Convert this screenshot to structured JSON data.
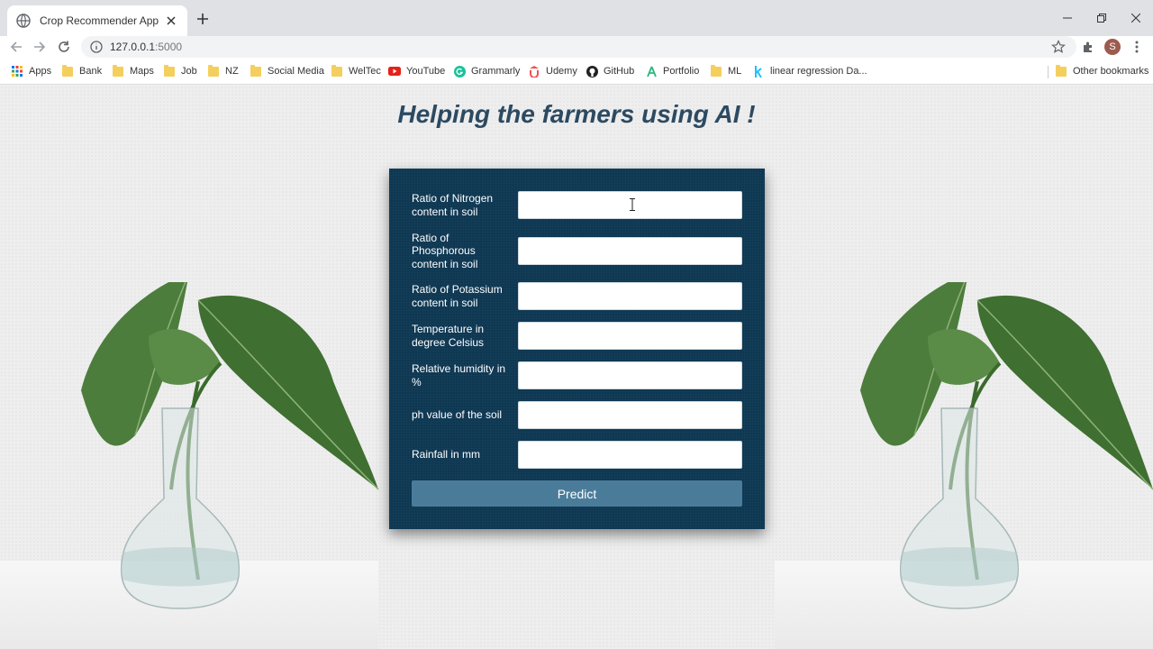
{
  "browser": {
    "tab_title": "Crop Recommender App",
    "url_host": "127.0.0.1",
    "url_port": ":5000",
    "avatar_letter": "S",
    "bookmarks": [
      {
        "label": "Apps",
        "icon": "apps-grid-icon"
      },
      {
        "label": "Bank",
        "icon": "folder-icon"
      },
      {
        "label": "Maps",
        "icon": "folder-icon"
      },
      {
        "label": "Job",
        "icon": "folder-icon"
      },
      {
        "label": "NZ",
        "icon": "folder-icon"
      },
      {
        "label": "Social Media",
        "icon": "folder-icon"
      },
      {
        "label": "WelTec",
        "icon": "folder-icon"
      },
      {
        "label": "YouTube",
        "icon": "youtube-icon"
      },
      {
        "label": "Grammarly",
        "icon": "grammarly-icon"
      },
      {
        "label": "Udemy",
        "icon": "udemy-icon"
      },
      {
        "label": "GitHub",
        "icon": "github-icon"
      },
      {
        "label": "Portfolio",
        "icon": "portfolio-icon"
      },
      {
        "label": "ML",
        "icon": "folder-icon"
      },
      {
        "label": "linear regression Da...",
        "icon": "k-icon"
      }
    ],
    "other_bookmarks": "Other bookmarks"
  },
  "page": {
    "heading": "Helping the farmers using AI !",
    "fields": [
      {
        "label": "Ratio of Nitrogen content in soil",
        "value": ""
      },
      {
        "label": "Ratio of Phosphorous content in soil",
        "value": ""
      },
      {
        "label": "Ratio of Potassium content in soil",
        "value": ""
      },
      {
        "label": "Temperature in degree Celsius",
        "value": ""
      },
      {
        "label": "Relative humidity in %",
        "value": ""
      },
      {
        "label": "ph value of the soil",
        "value": ""
      },
      {
        "label": "Rainfall in mm",
        "value": ""
      }
    ],
    "submit_label": "Predict"
  },
  "colors": {
    "form_bg": "#0e3752",
    "button_bg": "#4a7c9a",
    "heading": "#2c4a61"
  }
}
